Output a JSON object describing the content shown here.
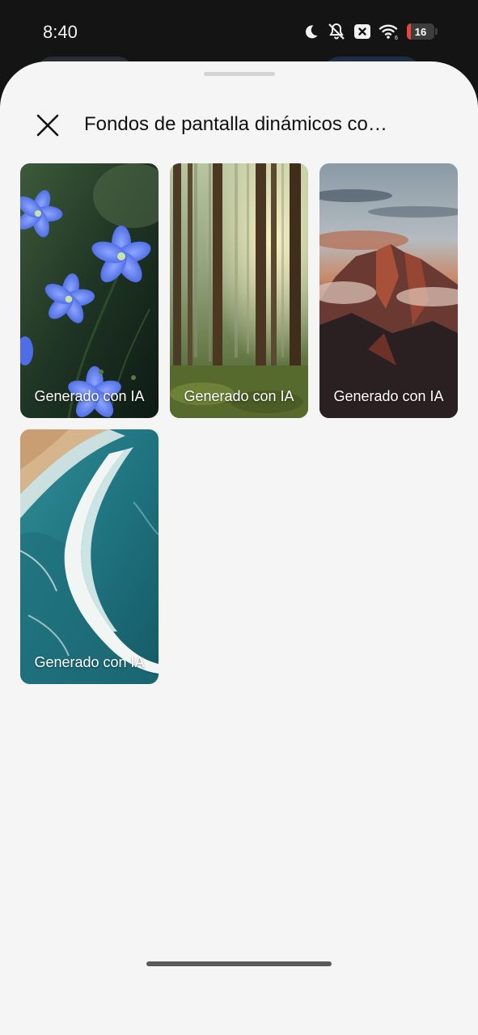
{
  "status_bar": {
    "time": "8:40",
    "battery_level": "16",
    "battery_color": "#e8453c",
    "icons": [
      "moon-icon",
      "bell-off-icon",
      "close-box-icon",
      "wifi-icon",
      "battery-icon"
    ]
  },
  "sheet": {
    "title": "Fondos de pantalla dinámicos co…",
    "close_icon": "close-icon"
  },
  "wallpapers": [
    {
      "subject": "blue-flowers",
      "label": "Generado con IA"
    },
    {
      "subject": "forest",
      "label": "Generado con IA"
    },
    {
      "subject": "mountain",
      "label": "Generado con IA"
    },
    {
      "subject": "ocean-waves",
      "label": "Generado con IA"
    }
  ]
}
